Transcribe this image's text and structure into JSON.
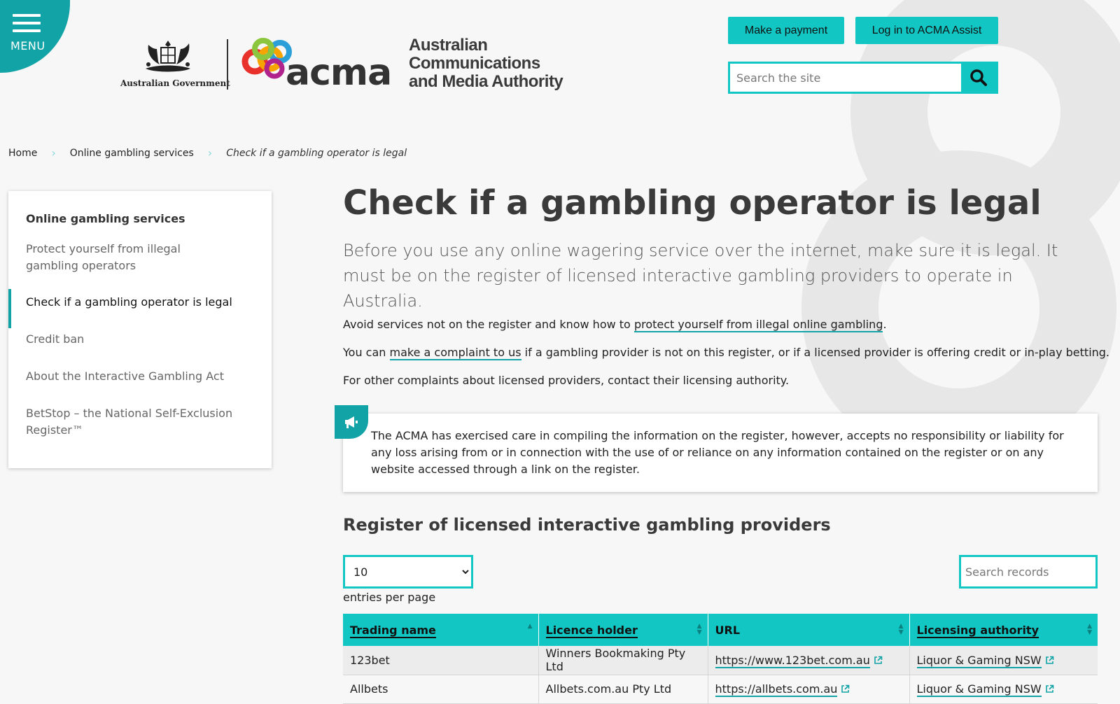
{
  "header": {
    "menu_label": "MENU",
    "gov_label": "Australian Government",
    "acma_word": "acma",
    "authority_name_line1": "Australian",
    "authority_name_line2": "Communications",
    "authority_name_line3": "and Media Authority",
    "pay_button": "Make a payment",
    "login_button": "Log in to ACMA Assist",
    "search_placeholder": "Search the site"
  },
  "breadcrumb": {
    "home": "Home",
    "section": "Online gambling services",
    "current": "Check if a gambling operator is legal"
  },
  "sidenav": {
    "heading": "Online gambling services",
    "items": [
      "Protect yourself from illegal gambling operators",
      "Check if a gambling operator is legal",
      "Credit ban",
      "About the Interactive Gambling Act",
      "BetStop – the National Self-Exclusion Register™"
    ]
  },
  "main": {
    "title": "Check if a gambling operator is legal",
    "lead": "Before you use any online wagering service over the internet, make sure it is legal. It must be on the register of licensed interactive gambling providers to operate in Australia.",
    "p1_before": "Avoid services not on the register and know how to ",
    "p1_link": "protect yourself from illegal online gambling",
    "p1_after": ".",
    "p2_before": "You can ",
    "p2_link": "make a complaint to us",
    "p2_after": " if a gambling provider is not on this register, or if a licensed provider is offering credit or in-play betting.",
    "p3": "For other complaints about licensed providers, contact their licensing authority.",
    "notice": "The ACMA has exercised care in compiling the information on the register, however, accepts no responsibility or liability for any loss arising from or in connection with the use of or reliance on any information contained on the register or on any website accessed through a link on the register.",
    "register_title": "Register of licensed interactive gambling providers",
    "per_page_value": "10",
    "per_page_label": "entries per page",
    "records_placeholder": "Search records"
  },
  "table": {
    "headers": [
      "Trading name",
      "Licence holder",
      "URL",
      "Licensing authority"
    ],
    "rows": [
      {
        "trading_name": "123bet",
        "licence_holder": "Winners Bookmaking Pty Ltd",
        "url": "https://www.123bet.com.au",
        "authority": "Liquor & Gaming NSW"
      },
      {
        "trading_name": "Allbets",
        "licence_holder": "Allbets.com.au Pty Ltd",
        "url": "https://allbets.com.au",
        "authority": "Liquor & Gaming NSW"
      }
    ]
  },
  "colors": {
    "accent": "#12c6c4",
    "accent_dark": "#12a3a6",
    "text": "#333333"
  },
  "icons": [
    "hamburger-icon",
    "search-icon",
    "megaphone-icon",
    "external-link-icon",
    "sort-icon"
  ]
}
